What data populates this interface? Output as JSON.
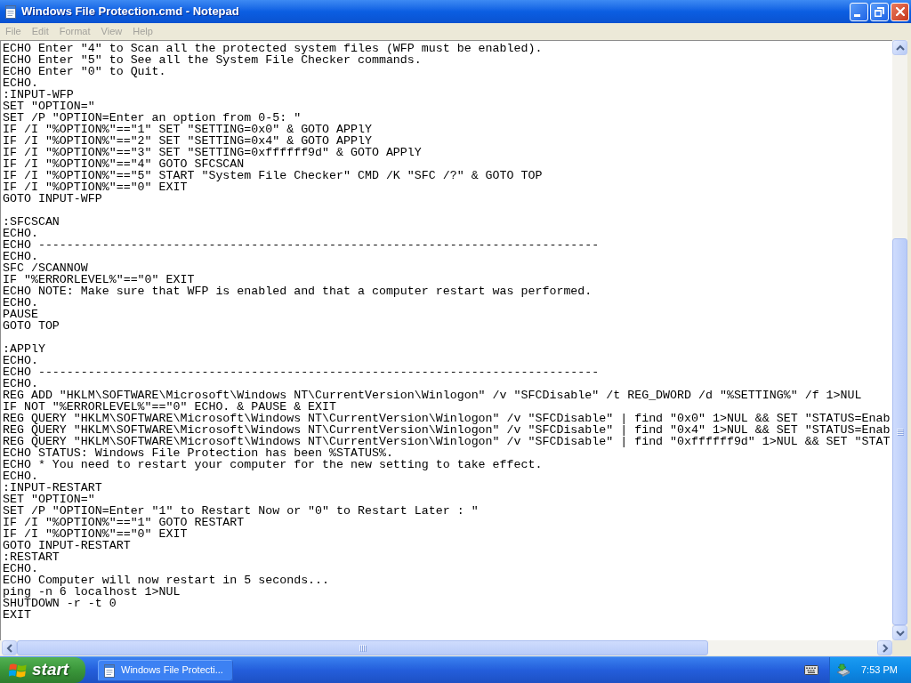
{
  "window": {
    "title": "Windows File Protection.cmd - Notepad"
  },
  "menu": [
    {
      "label": "File",
      "disabled": true
    },
    {
      "label": "Edit",
      "disabled": true
    },
    {
      "label": "Format",
      "disabled": true
    },
    {
      "label": "View",
      "disabled": true
    },
    {
      "label": "Help",
      "disabled": true
    }
  ],
  "document": {
    "blocks": [
      [
        "ECHO Enter \"4\" to Scan all the protected system files (WFP must be enabled).",
        "ECHO Enter \"5\" to See all the System File Checker commands.",
        "ECHO Enter \"0\" to Quit.",
        "ECHO.",
        ":INPUT-WFP",
        "SET \"OPTION=\"",
        "SET /P \"OPTION=Enter an option from 0-5: \"",
        "IF /I \"%OPTION%\"==\"1\" SET \"SETTING=0x0\" & GOTO APPlY",
        "IF /I \"%OPTION%\"==\"2\" SET \"SETTING=0x4\" & GOTO APPlY",
        "IF /I \"%OPTION%\"==\"3\" SET \"SETTING=0xffffff9d\" & GOTO APPlY",
        "IF /I \"%OPTION%\"==\"4\" GOTO SFCSCAN",
        "IF /I \"%OPTION%\"==\"5\" START \"System File Checker\" CMD /K \"SFC /?\" & GOTO TOP",
        "IF /I \"%OPTION%\"==\"0\" EXIT",
        "GOTO INPUT-WFP"
      ],
      [
        ":SFCSCAN",
        "ECHO.",
        "ECHO -------------------------------------------------------------------------------",
        "ECHO.",
        "SFC /SCANNOW",
        "IF \"%ERRORLEVEL%\"==\"0\" EXIT",
        "ECHO NOTE: Make sure that WFP is enabled and that a computer restart was performed.",
        "ECHO.",
        "PAUSE",
        "GOTO TOP"
      ],
      [
        ":APPlY",
        "ECHO.",
        "ECHO -------------------------------------------------------------------------------",
        "ECHO.",
        "REG ADD \"HKLM\\SOFTWARE\\Microsoft\\Windows NT\\CurrentVersion\\Winlogon\" /v \"SFCDisable\" /t REG_DWORD /d \"%SETTING%\" /f 1>NUL",
        "IF NOT \"%ERRORLEVEL%\"==\"0\" ECHO. & PAUSE & EXIT",
        "REG QUERY \"HKLM\\SOFTWARE\\Microsoft\\Windows NT\\CurrentVersion\\Winlogon\" /v \"SFCDisable\" | find \"0x0\" 1>NUL && SET \"STATUS=Enab",
        "REG QUERY \"HKLM\\SOFTWARE\\Microsoft\\Windows NT\\CurrentVersion\\Winlogon\" /v \"SFCDisable\" | find \"0x4\" 1>NUL && SET \"STATUS=Enab",
        "REG QUERY \"HKLM\\SOFTWARE\\Microsoft\\Windows NT\\CurrentVersion\\Winlogon\" /v \"SFCDisable\" | find \"0xffffff9d\" 1>NUL && SET \"STAT",
        "ECHO STATUS: Windows File Protection has been %STATUS%.",
        "ECHO * You need to restart your computer for the new setting to take effect.",
        "ECHO.",
        ":INPUT-RESTART",
        "SET \"OPTION=\"",
        "SET /P \"OPTION=Enter \"1\" to Restart Now or \"0\" to Restart Later : \"",
        "IF /I \"%OPTION%\"==\"1\" GOTO RESTART",
        "IF /I \"%OPTION%\"==\"0\" EXIT",
        "GOTO INPUT-RESTART",
        ":RESTART",
        "ECHO.",
        "ECHO Computer will now restart in 5 seconds...",
        "ping -n 6 localhost 1>NUL",
        "SHUTDOWN -r -t 0",
        "EXIT"
      ]
    ]
  },
  "taskbar": {
    "start": "start",
    "tasks": [
      {
        "label": "Windows File Protecti...",
        "selected": false
      }
    ],
    "clock": "7:53 PM"
  }
}
